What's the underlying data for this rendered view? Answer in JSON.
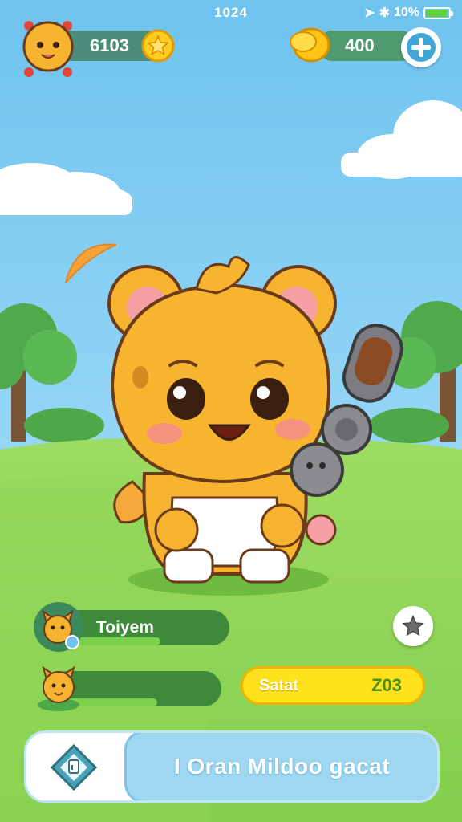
{
  "status_bar": {
    "time": "1024",
    "battery_label": "10%"
  },
  "header": {
    "level_value": "6103",
    "coin_value": "400",
    "add_icon": "plus-icon"
  },
  "progress": [
    {
      "label": "Toiyem",
      "fill": 0.62
    },
    {
      "label": "",
      "fill": 0.63
    }
  ],
  "score_button": {
    "label": "Satat",
    "value": "Z03"
  },
  "action_button": {
    "label": "I Oran Mildoo gacat"
  },
  "colors": {
    "sky": "#7fcaf0",
    "grass": "#8dd35a",
    "accent_yellow": "#ffe21c",
    "button_blue": "#9fd7f1"
  },
  "icons": [
    "avatar-mascot",
    "star-coin-icon",
    "gold-coin-icon",
    "plus-icon",
    "star-icon",
    "game-card-icon"
  ]
}
